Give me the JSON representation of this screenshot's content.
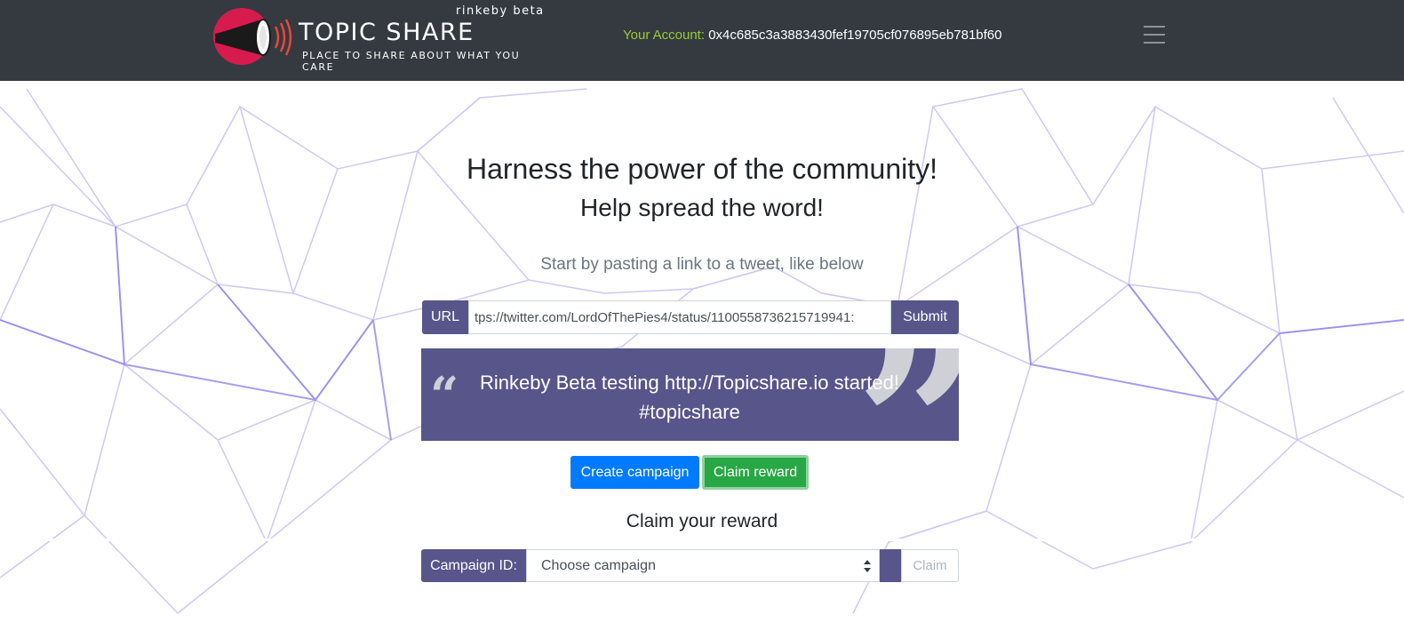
{
  "brand": {
    "env_label": "rinkeby beta",
    "title": "TOPIC SHARE",
    "tagline": "PLACE TO SHARE ABOUT WHAT YOU CARE"
  },
  "account": {
    "label": "Your Account:",
    "address": "0x4c685c3a3883430fef19705cf076895eb781bf60"
  },
  "hero": {
    "headline": "Harness the power of the community!",
    "subheadline": "Help spread the word!",
    "lead": "Start by pasting a link to a tweet, like below"
  },
  "url_form": {
    "prefix_label": "URL",
    "value": ":tps://twitter.com/LordOfThePies4/status/1100558736215719941",
    "submit_label": "Submit"
  },
  "tweet": {
    "text": "Rinkeby Beta testing http://Topicshare.io started! #topicshare"
  },
  "actions": {
    "create_campaign_label": "Create campaign",
    "claim_reward_label": "Claim reward"
  },
  "claim": {
    "heading": "Claim your reward",
    "campaign_label": "Campaign ID:",
    "select_value": "Choose campaign",
    "claim_label": "Claim"
  },
  "colors": {
    "navbar": "#343a40",
    "accent": "#58558a",
    "account_label": "#9acd32",
    "primary": "#007bff",
    "success": "#28a745",
    "logo_red": "#d81b4e"
  }
}
